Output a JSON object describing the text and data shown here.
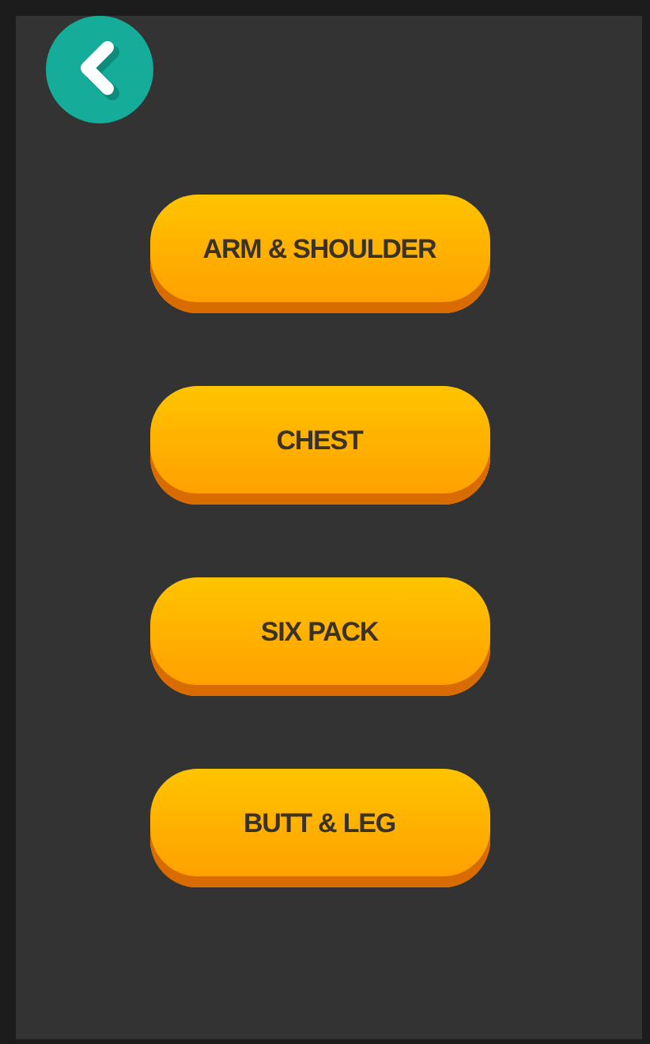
{
  "categories": [
    {
      "label": "ARM & SHOULDER"
    },
    {
      "label": "CHEST"
    },
    {
      "label": "SIX PACK"
    },
    {
      "label": "BUTT & LEG"
    }
  ]
}
